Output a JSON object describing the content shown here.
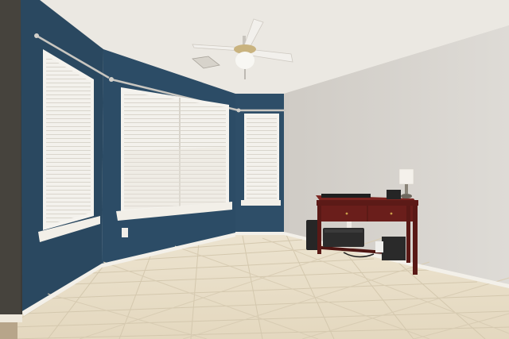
{
  "image": {
    "alt": "",
    "colors": {
      "ceiling": "#e9e6e0",
      "accent_wall": "#2c4a63",
      "accent_wall_shade": "#223c52",
      "side_wall": "#d6d3ce",
      "floor_tile": "#e7dcc5",
      "grout": "#cfc3aa",
      "trim": "#f2efe8",
      "blind": "#f1efe9",
      "table_wood": "#6e1f1c",
      "device_dark": "#2b2b2b"
    }
  }
}
